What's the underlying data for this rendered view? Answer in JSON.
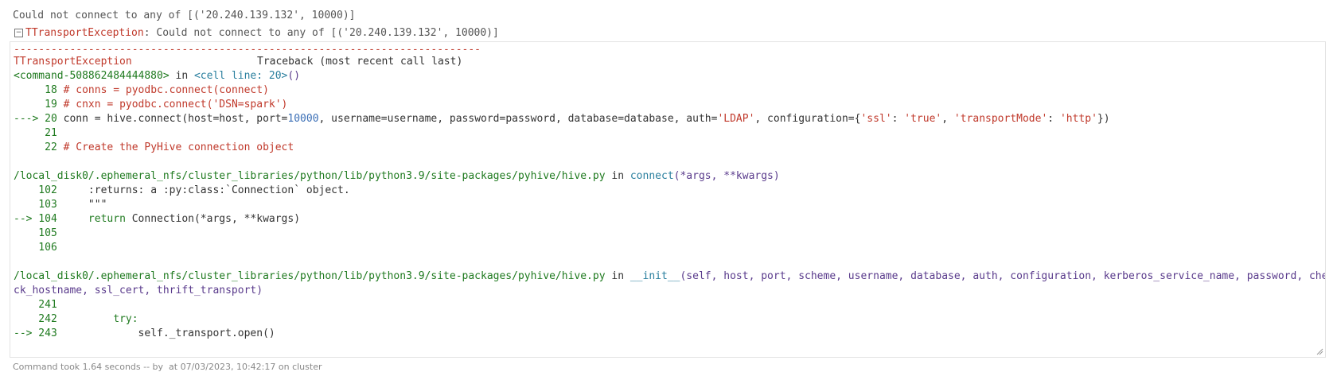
{
  "message": "Could not connect to any of [('20.240.139.132', 10000)]",
  "exception": {
    "name": "TTransportException",
    "text": ": Could not connect to any of [('20.240.139.132', 10000)]"
  },
  "traceback": {
    "separator": "---------------------------------------------------------------------------",
    "exc_name": "TTransportException",
    "header": "Traceback (most recent call last)",
    "frame1": {
      "location": "<command-508862484444880>",
      "in": " in ",
      "func": "<cell line: 20>",
      "args": "()",
      "l18_no": "     18 ",
      "l18": "# conns = pyodbc.connect(connect)",
      "l19_no": "     19 ",
      "l19": "# cnxn = pyodbc.connect('DSN=spark')",
      "l20_arrow": "---> 20 ",
      "l20_a": "conn = hive.connect(host=host, port=",
      "l20_port": "10000",
      "l20_b": ", username=username, password=password, database=database, auth=",
      "l20_auth": "'LDAP'",
      "l20_c": ", configuration={",
      "l20_k1": "'ssl'",
      "l20_sep1": ": ",
      "l20_v1": "'true'",
      "l20_sep2": ", ",
      "l20_k2": "'transportMode'",
      "l20_sep3": ": ",
      "l20_v2": "'http'",
      "l20_end": "})",
      "l21_no": "     21",
      "l22_no": "     22 ",
      "l22": "# Create the PyHive connection object"
    },
    "frame2": {
      "path": "/local_disk0/.ephemeral_nfs/cluster_libraries/python/lib/python3.9/site-packages/pyhive/hive.py",
      "in": " in ",
      "func": "connect",
      "args": "(*args, **kwargs)",
      "l102_no": "    102 ",
      "l102": "    :returns: a :py:class:`Connection` object.",
      "l103_no": "    103 ",
      "l103": "    \"\"\"",
      "l104_arrow": "--> 104 ",
      "l104_kw": "    return ",
      "l104": "Connection(*args, **kwargs)",
      "l105_no": "    105",
      "l106_no": "    106"
    },
    "frame3": {
      "path": "/local_disk0/.ephemeral_nfs/cluster_libraries/python/lib/python3.9/site-packages/pyhive/hive.py",
      "in": " in ",
      "func": "__init__",
      "args1": "(self, host, port, scheme, username, database, auth, configuration, kerberos_service_name, password, che",
      "args2": "ck_hostname, ssl_cert, thrift_transport)",
      "l241_no": "    241",
      "l242_no": "    242 ",
      "l242": "        try:",
      "l243_arrow": "--> 243 ",
      "l243": "            self._transport.open()"
    }
  },
  "status": "Command took 1.64 seconds -- by  at 07/03/2023, 10:42:17 on cluster"
}
